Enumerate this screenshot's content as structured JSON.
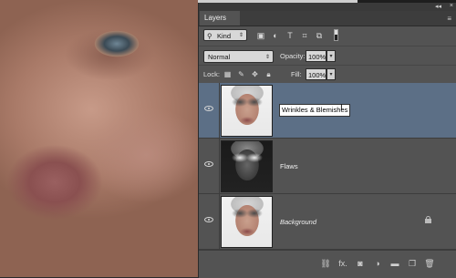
{
  "panel": {
    "tab_label": "Layers",
    "collapse_icon": "double-chevron-left-icon",
    "menu_icon": "panel-menu-icon"
  },
  "filter": {
    "kind_label": "Kind",
    "icons": [
      "pixel-filter-icon",
      "adjustment-filter-icon",
      "type-filter-icon",
      "shape-filter-icon",
      "smart-object-filter-icon"
    ]
  },
  "blend": {
    "mode": "Normal",
    "opacity_label": "Opacity:",
    "opacity_value": "100%",
    "lock_label": "Lock:",
    "fill_label": "Fill:",
    "fill_value": "100%"
  },
  "layers": [
    {
      "name": "Wrinkles & Blemishes",
      "selected": true,
      "editing": true
    },
    {
      "name": "Flaws",
      "selected": false
    },
    {
      "name": "Background",
      "selected": false,
      "locked": true,
      "italic": true
    }
  ],
  "bottom_icons": [
    "link-icon",
    "fx-icon",
    "mask-icon",
    "adjustment-icon",
    "group-folder-icon",
    "new-layer-icon",
    "trash-icon"
  ],
  "fx_label": "fx."
}
